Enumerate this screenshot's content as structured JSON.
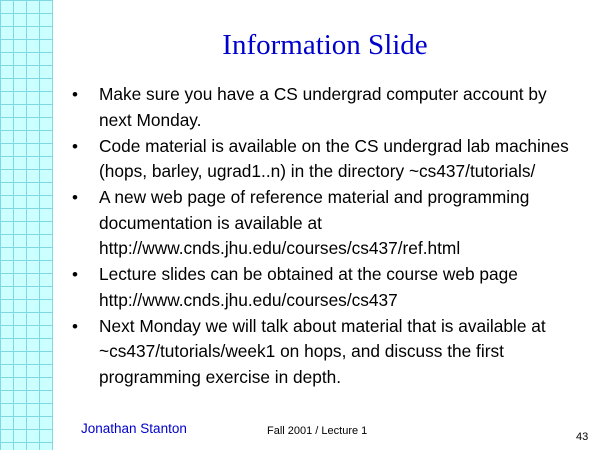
{
  "slide": {
    "title": "Information Slide",
    "bullets": [
      "Make sure you have a CS undergrad computer account by next Monday.",
      "Code material is available on the CS undergrad lab machines (hops, barley, ugrad1..n) in the directory ~cs437/tutorials/",
      "A new web page of reference material and programming documentation is available at http://www.cnds.jhu.edu/courses/cs437/ref.html",
      "Lecture slides can be obtained at the course web page http://www.cnds.jhu.edu/courses/cs437",
      "Next Monday we will talk about material that is available at ~cs437/tutorials/week1 on hops, and discuss the first programming exercise in depth."
    ],
    "bullet_symbol": "•"
  },
  "footer": {
    "author": "Jonathan Stanton",
    "course": "Fall  2001 / Lecture 1",
    "page": "43"
  },
  "colors": {
    "title": "#0000cc",
    "grid_background": "#ccffff",
    "grid_lines": "#7fd9e5"
  }
}
